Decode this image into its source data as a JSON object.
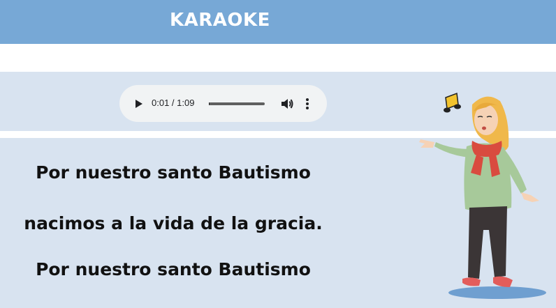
{
  "header": {
    "title": "KARAOKE"
  },
  "audio": {
    "time": "0:01 / 1:09",
    "progress": 0.014,
    "play_icon": "play-icon",
    "volume_icon": "volume-icon",
    "menu_icon": "more-vert-icon"
  },
  "lyrics": [
    "Por nuestro santo Bautismo",
    "nacimos a la vida de la gracia.",
    "Por nuestro santo Bautismo"
  ],
  "colors": {
    "header": "#77a8d6",
    "band": "#d8e3f0",
    "player": "#f1f3f4"
  }
}
